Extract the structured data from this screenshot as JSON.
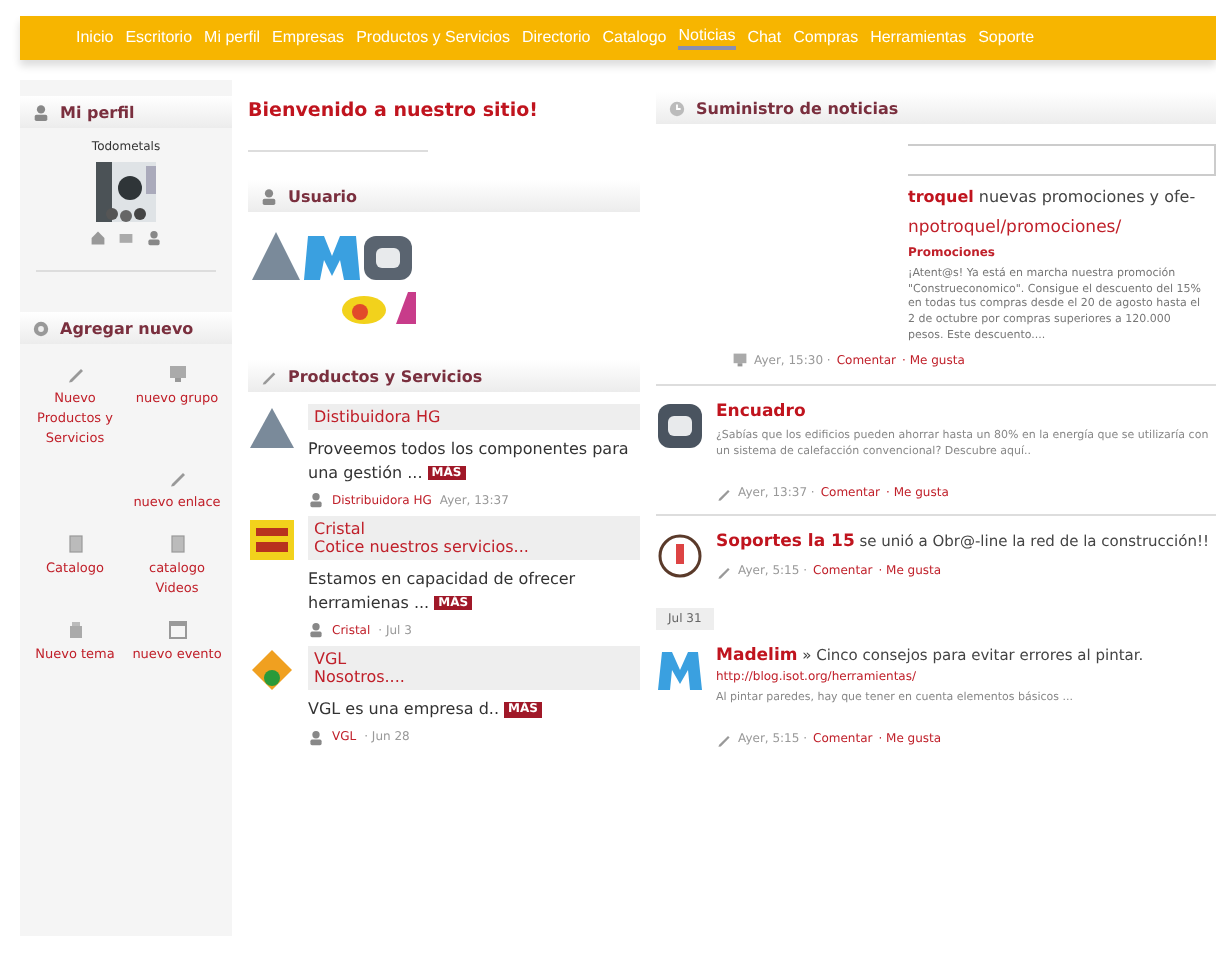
{
  "nav": [
    {
      "label": "Inicio",
      "selected": false
    },
    {
      "label": "Escritorio",
      "selected": false
    },
    {
      "label": "Mi perfil",
      "selected": false
    },
    {
      "label": "Empresas",
      "selected": false
    },
    {
      "label": "Productos y Servicios",
      "selected": false
    },
    {
      "label": "Directorio",
      "selected": false
    },
    {
      "label": "Catalogo",
      "selected": false
    },
    {
      "label": "Noticias",
      "selected": true
    },
    {
      "label": "Chat",
      "selected": false
    },
    {
      "label": "Compras",
      "selected": false
    },
    {
      "label": "Herramientas",
      "selected": false
    },
    {
      "label": "Soporte",
      "selected": false
    }
  ],
  "sidebar": {
    "profile": {
      "title": "Mi perfil",
      "name": "Todometals"
    },
    "add_new": {
      "title": "Agregar nuevo",
      "items": [
        {
          "label": "Nuevo Productos y Servicios"
        },
        {
          "label": "nuevo grupo"
        },
        {
          "label": "nuevo enlace"
        },
        {
          "label": "Catalogo"
        },
        {
          "label": "catalogo Videos"
        },
        {
          "label": "Nuevo tema"
        },
        {
          "label": "nuevo evento"
        }
      ]
    }
  },
  "welcome": "Bienvenido a nuestro sitio!",
  "users": {
    "title": "Usuario"
  },
  "products": {
    "title": "Productos y Servicios",
    "posts": [
      {
        "company": "Distibuidora HG",
        "text": "Proveemos todos los componentes para una gestión ...",
        "more": "MÁS",
        "author": "Distribuidora HG",
        "time": "Ayer, 13:37"
      },
      {
        "company": "Cristal",
        "subtitle": "Cotice nuestros servicios...",
        "text": "Estamos en capacidad de ofrecer herramienas ...",
        "more": "MÁS",
        "author": "Cristal",
        "time": "· Jul 3"
      },
      {
        "company": "VGL",
        "subtitle": "Nosotros....",
        "text": "VGL es una empresa d..",
        "more": "MÁS",
        "author": "VGL",
        "time": "· Jun 28"
      }
    ]
  },
  "feed": {
    "title": "Suministro de noticias",
    "first": {
      "name": "troquel",
      "text": "nuevas promociones y ofe-",
      "link": "npotroquel/promociones/",
      "subtitle": "Promociones",
      "body": "¡Atent@s! Ya está en marcha nuestra promoción \"Construeconomico\". Consigue el descuento del 15% en todas tus compras desde el 20 de agosto hasta el 2 de octubre por compras superiores a 120.000 pesos. Este descuento....",
      "time": "Ayer, 15:30 ·",
      "comment": "Comentar",
      "like": "· Me gusta"
    },
    "items": [
      {
        "name": "Encuadro",
        "body": "¿Sabías que los edificios pueden ahorrar hasta un 80% en la energía que se utilizaría con un sistema de calefacción convencional? Descubre aquí..",
        "time": "Ayer, 13:37 ·",
        "comment": "Comentar",
        "like": "· Me gusta"
      },
      {
        "name": "Soportes la 15",
        "text": "se unió a Obr@-line la red de la construcción!!",
        "time": "Ayer, 5:15 ·",
        "comment": "Comentar",
        "like": "· Me gusta"
      },
      {
        "date": "Jul 31",
        "name": "Madelim",
        "text": "» Cinco consejos para evitar errores al pintar.",
        "link": "http://blog.isot.org/herramientas/",
        "body": "Al pintar paredes, hay que tener en cuenta elementos básicos ...",
        "time": "Ayer, 5:15 ·",
        "comment": "Comentar",
        "like": "· Me gusta"
      }
    ]
  }
}
